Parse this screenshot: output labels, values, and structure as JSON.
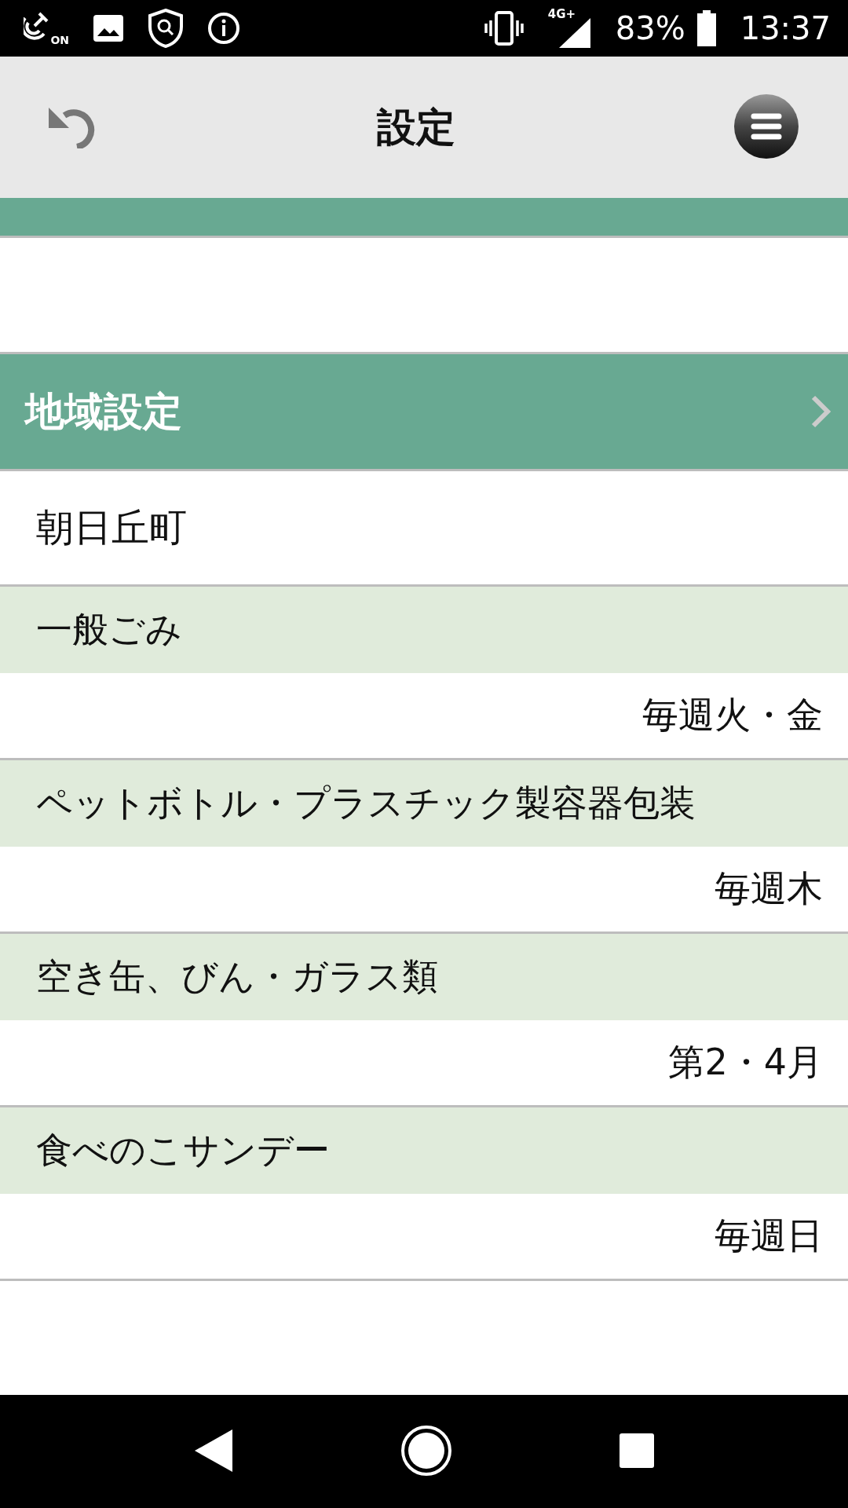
{
  "status_bar": {
    "nfc_label": "ON",
    "network": "4G+",
    "battery": "83%",
    "time": "13:37"
  },
  "header": {
    "title": "設定"
  },
  "section": {
    "title": "地域設定"
  },
  "area": "朝日丘町",
  "collections": [
    {
      "category": "一般ごみ",
      "schedule": "毎週火・金"
    },
    {
      "category": "ペットボトル・プラスチック製容器包装",
      "schedule": "毎週木"
    },
    {
      "category": "空き缶、びん・ガラス類",
      "schedule": "第2・4月"
    },
    {
      "category": "食べのこサンデー",
      "schedule": "毎週日"
    }
  ]
}
